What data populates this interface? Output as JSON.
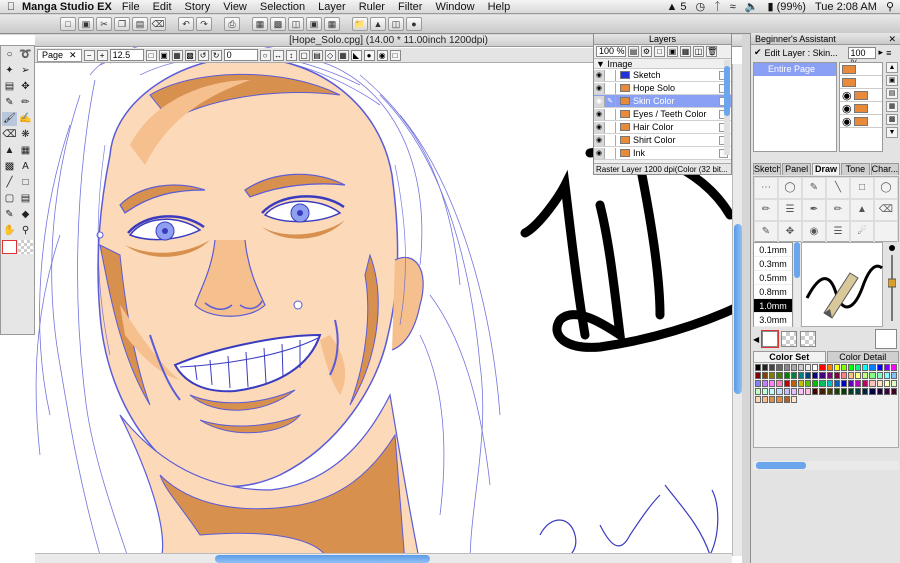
{
  "menubar": {
    "app_name": "Manga Studio EX",
    "menus": [
      "File",
      "Edit",
      "Story",
      "View",
      "Selection",
      "Layer",
      "Ruler",
      "Filter",
      "Window",
      "Help"
    ],
    "status": {
      "adobe": "5",
      "battery": "(99%)",
      "clock": "Tue 2:08 AM"
    }
  },
  "document": {
    "title": "[Hope_Solo.cpg] (14.00 * 11.00inch 1200dpi)",
    "page_tab": "Page",
    "zoom": "12.5",
    "rotation": "0"
  },
  "layers_palette": {
    "title": "Layers",
    "zoom": "100 %",
    "group": "Image",
    "items": [
      {
        "name": "Sketch",
        "color": "#2433d9"
      },
      {
        "name": "Hope Solo",
        "color": "#e88a3a"
      },
      {
        "name": "Skin Color",
        "color": "#e88a3a",
        "selected": true
      },
      {
        "name": "Eyes / Teeth Color",
        "color": "#e88a3a"
      },
      {
        "name": "Hair Color",
        "color": "#e88a3a"
      },
      {
        "name": "Shirt Color",
        "color": "#e88a3a"
      },
      {
        "name": "Ink",
        "color": "#e88a3a"
      }
    ],
    "status": "Raster Layer 1200 dpi(Color (32 bit..."
  },
  "assistant": {
    "title": "Beginner's Assistant",
    "edit_layer": "Edit Layer : Skin...",
    "zoom": "100 %",
    "list_item": "Entire Page"
  },
  "tool_tabs": [
    "Sketch",
    "Panel",
    "Draw",
    "Tone",
    "Char..."
  ],
  "pen_sizes": [
    "0.1mm",
    "0.3mm",
    "0.5mm",
    "0.8mm",
    "1.0mm",
    "3.0mm"
  ],
  "selected_pen_size": "1.0mm",
  "color_tabs": [
    "Color Set",
    "Color Detail"
  ],
  "colors": {
    "sketch_blue": "#5a5cd8",
    "skin_light": "#fcd9b8",
    "skin_mid": "#f6bf8e",
    "skin_dark": "#d8904f",
    "selection_blue": "#8aa0f4",
    "scroll_blue": "#6ba5ec"
  },
  "palette_swatches": [
    "#000000",
    "#222222",
    "#444444",
    "#666666",
    "#888888",
    "#aaaaaa",
    "#cccccc",
    "#eeeeee",
    "#ffffff",
    "#ff0000",
    "#ff8000",
    "#ffff00",
    "#80ff00",
    "#00ff00",
    "#00ff80",
    "#00ffff",
    "#0080ff",
    "#0000ff",
    "#8000ff",
    "#ff00ff",
    "#800000",
    "#804000",
    "#808000",
    "#408000",
    "#008000",
    "#008040",
    "#008080",
    "#004080",
    "#000080",
    "#400080",
    "#800080",
    "#800040",
    "#ff8080",
    "#ffc080",
    "#ffff80",
    "#c0ff80",
    "#80ff80",
    "#80ffc0",
    "#80ffff",
    "#80c0ff",
    "#8080ff",
    "#c080ff",
    "#ff80ff",
    "#ff80c0",
    "#c00000",
    "#c06000",
    "#c0c000",
    "#60c000",
    "#00c000",
    "#00c060",
    "#00c0c0",
    "#0060c0",
    "#0000c0",
    "#6000c0",
    "#c000c0",
    "#c00060",
    "#ffc0c0",
    "#ffe0c0",
    "#ffffc0",
    "#e0ffc0",
    "#c0ffc0",
    "#c0ffe0",
    "#c0ffff",
    "#c0e0ff",
    "#c0c0ff",
    "#e0c0ff",
    "#ffc0ff",
    "#ffc0e0",
    "#400000",
    "#402000",
    "#404000",
    "#204000",
    "#004000",
    "#004020",
    "#004040",
    "#002040",
    "#000040",
    "#200040",
    "#400040",
    "#400020",
    "#fcd9b8",
    "#f6bf8e",
    "#d8904f",
    "#e88a3a",
    "#b06020",
    "#ffe6cc"
  ]
}
